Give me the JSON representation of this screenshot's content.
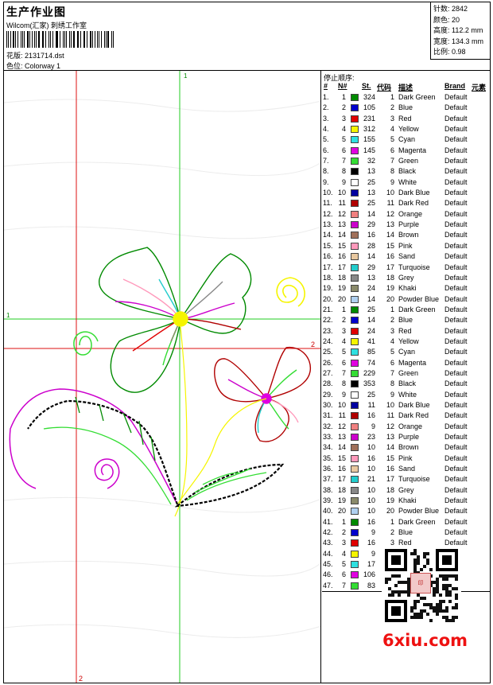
{
  "header": {
    "title": "生产作业图",
    "company": "Wilcom(汇家) 刺绣工作室",
    "design_label": "花版:",
    "design_file": "2131714.dst",
    "colorway_label": "色位:",
    "colorway": "Colorway 1"
  },
  "stats": [
    {
      "label": "针数:",
      "value": "2842"
    },
    {
      "label": "颜色:",
      "value": "20"
    },
    {
      "label": "高度:",
      "value": "112.2 mm"
    },
    {
      "label": "宽度:",
      "value": "134.3 mm"
    },
    {
      "label": "比例:",
      "value": "0.98"
    }
  ],
  "canvas": {
    "vertical_green_label": "1",
    "horizontal_green_label": "1",
    "horizontal_red_label": "2",
    "vertical_red_label": "2"
  },
  "table": {
    "title": "停止顺序:",
    "headers": {
      "num": "#",
      "needle": "N#",
      "stitches": "St.",
      "code": "代码",
      "desc": "描述",
      "brand": "Brand",
      "element": "元素"
    },
    "rows": [
      {
        "n": "1.",
        "needle": "1",
        "color": "#008a00",
        "st": "324",
        "code": "1",
        "desc": "Dark Green",
        "brand": "Default"
      },
      {
        "n": "2.",
        "needle": "2",
        "color": "#0000cc",
        "st": "105",
        "code": "2",
        "desc": "Blue",
        "brand": "Default"
      },
      {
        "n": "3.",
        "needle": "3",
        "color": "#e00000",
        "st": "231",
        "code": "3",
        "desc": "Red",
        "brand": "Default"
      },
      {
        "n": "4.",
        "needle": "4",
        "color": "#f5f500",
        "st": "312",
        "code": "4",
        "desc": "Yellow",
        "brand": "Default"
      },
      {
        "n": "5.",
        "needle": "5",
        "color": "#2ee0e0",
        "st": "155",
        "code": "5",
        "desc": "Cyan",
        "brand": "Default"
      },
      {
        "n": "6.",
        "needle": "6",
        "color": "#e000e0",
        "st": "145",
        "code": "6",
        "desc": "Magenta",
        "brand": "Default"
      },
      {
        "n": "7.",
        "needle": "7",
        "color": "#33dd33",
        "st": "32",
        "code": "7",
        "desc": "Green",
        "brand": "Default"
      },
      {
        "n": "8.",
        "needle": "8",
        "color": "#000000",
        "st": "13",
        "code": "8",
        "desc": "Black",
        "brand": "Default"
      },
      {
        "n": "9.",
        "needle": "9",
        "color": "#ffffff",
        "st": "25",
        "code": "9",
        "desc": "White",
        "brand": "Default"
      },
      {
        "n": "10.",
        "needle": "10",
        "color": "#0000a0",
        "st": "13",
        "code": "10",
        "desc": "Dark Blue",
        "brand": "Default"
      },
      {
        "n": "11.",
        "needle": "11",
        "color": "#b00000",
        "st": "25",
        "code": "11",
        "desc": "Dark Red",
        "brand": "Default"
      },
      {
        "n": "12.",
        "needle": "12",
        "color": "#f08080",
        "st": "14",
        "code": "12",
        "desc": "Orange",
        "brand": "Default"
      },
      {
        "n": "13.",
        "needle": "13",
        "color": "#cc00cc",
        "st": "29",
        "code": "13",
        "desc": "Purple",
        "brand": "Default"
      },
      {
        "n": "14.",
        "needle": "14",
        "color": "#a0705a",
        "st": "16",
        "code": "14",
        "desc": "Brown",
        "brand": "Default"
      },
      {
        "n": "15.",
        "needle": "15",
        "color": "#ff99bb",
        "st": "28",
        "code": "15",
        "desc": "Pink",
        "brand": "Default"
      },
      {
        "n": "16.",
        "needle": "16",
        "color": "#e8c8a0",
        "st": "14",
        "code": "16",
        "desc": "Sand",
        "brand": "Default"
      },
      {
        "n": "17.",
        "needle": "17",
        "color": "#22cccc",
        "st": "29",
        "code": "17",
        "desc": "Turquoise",
        "brand": "Default"
      },
      {
        "n": "18.",
        "needle": "18",
        "color": "#888888",
        "st": "13",
        "code": "18",
        "desc": "Grey",
        "brand": "Default"
      },
      {
        "n": "19.",
        "needle": "19",
        "color": "#8a8a6a",
        "st": "24",
        "code": "19",
        "desc": "Khaki",
        "brand": "Default"
      },
      {
        "n": "20.",
        "needle": "20",
        "color": "#b0d0f0",
        "st": "14",
        "code": "20",
        "desc": "Powder Blue",
        "brand": "Default"
      },
      {
        "n": "21.",
        "needle": "1",
        "color": "#008a00",
        "st": "25",
        "code": "1",
        "desc": "Dark Green",
        "brand": "Default"
      },
      {
        "n": "22.",
        "needle": "2",
        "color": "#0000cc",
        "st": "14",
        "code": "2",
        "desc": "Blue",
        "brand": "Default"
      },
      {
        "n": "23.",
        "needle": "3",
        "color": "#e00000",
        "st": "24",
        "code": "3",
        "desc": "Red",
        "brand": "Default"
      },
      {
        "n": "24.",
        "needle": "4",
        "color": "#f5f500",
        "st": "41",
        "code": "4",
        "desc": "Yellow",
        "brand": "Default"
      },
      {
        "n": "25.",
        "needle": "5",
        "color": "#2ee0e0",
        "st": "85",
        "code": "5",
        "desc": "Cyan",
        "brand": "Default"
      },
      {
        "n": "26.",
        "needle": "6",
        "color": "#e000e0",
        "st": "74",
        "code": "6",
        "desc": "Magenta",
        "brand": "Default"
      },
      {
        "n": "27.",
        "needle": "7",
        "color": "#33dd33",
        "st": "229",
        "code": "7",
        "desc": "Green",
        "brand": "Default"
      },
      {
        "n": "28.",
        "needle": "8",
        "color": "#000000",
        "st": "353",
        "code": "8",
        "desc": "Black",
        "brand": "Default"
      },
      {
        "n": "29.",
        "needle": "9",
        "color": "#ffffff",
        "st": "25",
        "code": "9",
        "desc": "White",
        "brand": "Default"
      },
      {
        "n": "30.",
        "needle": "10",
        "color": "#0000a0",
        "st": "11",
        "code": "10",
        "desc": "Dark Blue",
        "brand": "Default"
      },
      {
        "n": "31.",
        "needle": "11",
        "color": "#b00000",
        "st": "16",
        "code": "11",
        "desc": "Dark Red",
        "brand": "Default"
      },
      {
        "n": "32.",
        "needle": "12",
        "color": "#f08080",
        "st": "9",
        "code": "12",
        "desc": "Orange",
        "brand": "Default"
      },
      {
        "n": "33.",
        "needle": "13",
        "color": "#cc00cc",
        "st": "23",
        "code": "13",
        "desc": "Purple",
        "brand": "Default"
      },
      {
        "n": "34.",
        "needle": "14",
        "color": "#a0705a",
        "st": "10",
        "code": "14",
        "desc": "Brown",
        "brand": "Default"
      },
      {
        "n": "35.",
        "needle": "15",
        "color": "#ff99bb",
        "st": "16",
        "code": "15",
        "desc": "Pink",
        "brand": "Default"
      },
      {
        "n": "36.",
        "needle": "16",
        "color": "#e8c8a0",
        "st": "10",
        "code": "16",
        "desc": "Sand",
        "brand": "Default"
      },
      {
        "n": "37.",
        "needle": "17",
        "color": "#22cccc",
        "st": "21",
        "code": "17",
        "desc": "Turquoise",
        "brand": "Default"
      },
      {
        "n": "38.",
        "needle": "18",
        "color": "#888888",
        "st": "10",
        "code": "18",
        "desc": "Grey",
        "brand": "Default"
      },
      {
        "n": "39.",
        "needle": "19",
        "color": "#8a8a6a",
        "st": "10",
        "code": "19",
        "desc": "Khaki",
        "brand": "Default"
      },
      {
        "n": "40.",
        "needle": "20",
        "color": "#b0d0f0",
        "st": "10",
        "code": "20",
        "desc": "Powder Blue",
        "brand": "Default"
      },
      {
        "n": "41.",
        "needle": "1",
        "color": "#008a00",
        "st": "16",
        "code": "1",
        "desc": "Dark Green",
        "brand": "Default"
      },
      {
        "n": "42.",
        "needle": "2",
        "color": "#0000cc",
        "st": "9",
        "code": "2",
        "desc": "Blue",
        "brand": "Default"
      },
      {
        "n": "43.",
        "needle": "3",
        "color": "#e00000",
        "st": "16",
        "code": "3",
        "desc": "Red",
        "brand": "Default"
      },
      {
        "n": "44.",
        "needle": "4",
        "color": "#f5f500",
        "st": "9",
        "code": "",
        "desc": "",
        "brand": ""
      },
      {
        "n": "45.",
        "needle": "5",
        "color": "#2ee0e0",
        "st": "17",
        "code": "",
        "desc": "",
        "brand": ""
      },
      {
        "n": "46.",
        "needle": "6",
        "color": "#e000e0",
        "st": "106",
        "code": "",
        "desc": "",
        "brand": ""
      },
      {
        "n": "47.",
        "needle": "7",
        "color": "#33dd33",
        "st": "83",
        "code": "",
        "desc": "",
        "brand": ""
      }
    ]
  },
  "watermark": "6xiu.com",
  "icons": {
    "qr": "qr-code-icon",
    "seal": "seal-stamp-icon",
    "barcode": "barcode-icon"
  }
}
